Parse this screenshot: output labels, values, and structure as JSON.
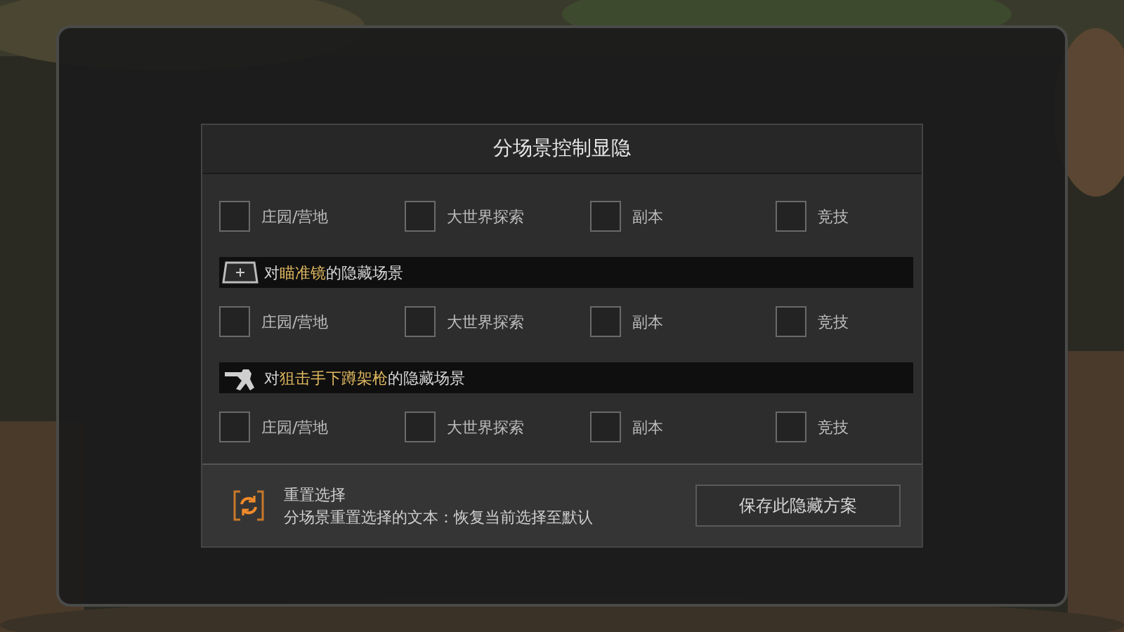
{
  "dialog": {
    "title": "分场景控制显隐",
    "sections": [
      {
        "options": [
          {
            "label": "庄园/营地",
            "checked": false
          },
          {
            "label": "大世界探索",
            "checked": false
          },
          {
            "label": "副本",
            "checked": false
          },
          {
            "label": "竞技",
            "checked": false
          }
        ]
      },
      {
        "kind": "scope",
        "header": "对**瞄准镜**的隐藏场景",
        "options": [
          {
            "label": "庄园/营地",
            "checked": false
          },
          {
            "label": "大世界探索",
            "checked": false
          },
          {
            "label": "副本",
            "checked": false
          },
          {
            "label": "竞技",
            "checked": false
          }
        ]
      },
      {
        "kind": "sniper",
        "header": "对**狙击手下蹲架枪**的隐藏场景",
        "options": [
          {
            "label": "庄园/营地",
            "checked": false
          },
          {
            "label": "大世界探索",
            "checked": false
          },
          {
            "label": "副本",
            "checked": false
          },
          {
            "label": "竞技",
            "checked": false
          }
        ]
      }
    ],
    "reset": {
      "title": "重置选择",
      "description": "分场景重置选择的文本：恢复当前选择至默认"
    },
    "save_button": "保存此隐藏方案"
  }
}
